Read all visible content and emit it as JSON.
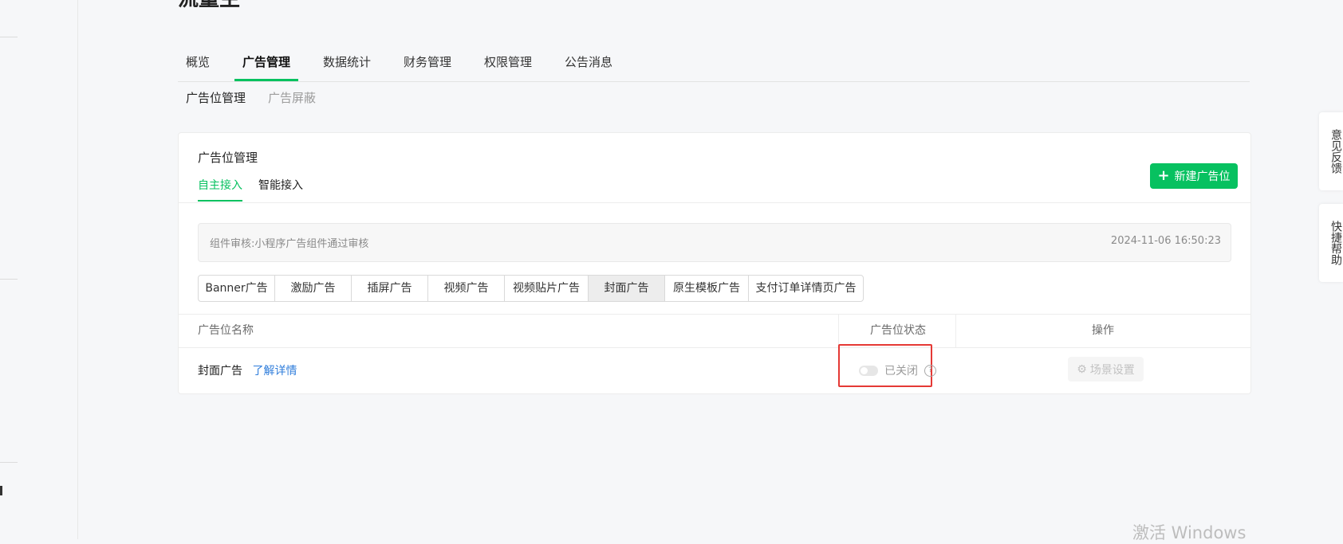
{
  "page": {
    "title": "流量主"
  },
  "main_tabs": [
    {
      "label": "概览"
    },
    {
      "label": "广告管理",
      "active": true
    },
    {
      "label": "数据统计"
    },
    {
      "label": "财务管理"
    },
    {
      "label": "权限管理"
    },
    {
      "label": "公告消息"
    }
  ],
  "sub_tabs": [
    {
      "label": "广告位管理",
      "active": true
    },
    {
      "label": "广告屏蔽",
      "disabled": true
    }
  ],
  "card": {
    "title": "广告位管理",
    "tabs": [
      {
        "label": "自主接入",
        "active": true
      },
      {
        "label": "智能接入"
      }
    ],
    "new_button": {
      "label": "新建广告位",
      "icon": "plus-icon"
    },
    "notice": {
      "text": "组件审核:小程序广告组件通过审核",
      "time": "2024-11-06 16:50:23"
    },
    "ad_types": [
      {
        "label": "Banner广告"
      },
      {
        "label": "激励广告"
      },
      {
        "label": "插屏广告"
      },
      {
        "label": "视频广告"
      },
      {
        "label": "视频贴片广告"
      },
      {
        "label": "封面广告",
        "active": true
      },
      {
        "label": "原生模板广告"
      },
      {
        "label": "支付订单详情页广告"
      }
    ],
    "table": {
      "headers": {
        "name": "广告位名称",
        "status": "广告位状态",
        "actions": "操作"
      },
      "rows": [
        {
          "name": "封面广告",
          "link": "了解详情",
          "status": "已关闭",
          "status_on": false,
          "action": "场景设置"
        }
      ]
    }
  },
  "floating": {
    "feedback": "意见反馈",
    "help": "快捷帮助"
  },
  "watermark": "激活 Windows",
  "colors": {
    "accent": "#07c160",
    "link": "#2f7ddb",
    "highlight": "#e53935"
  }
}
